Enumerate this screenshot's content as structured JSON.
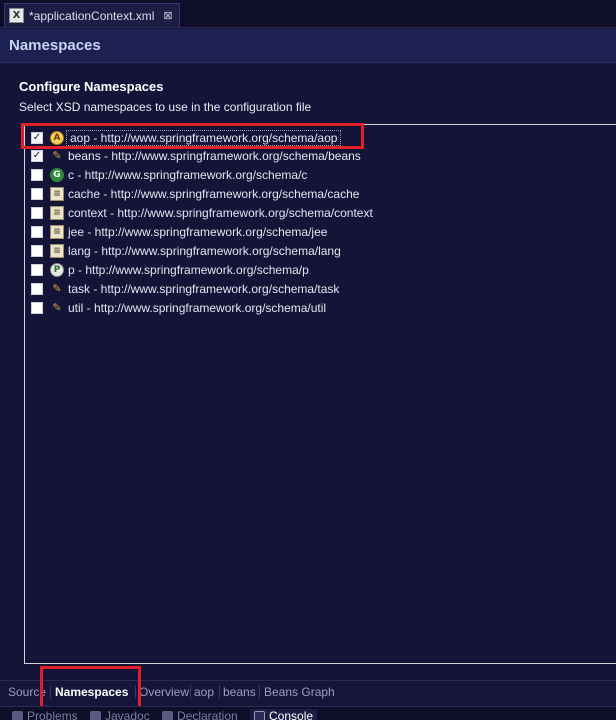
{
  "editor": {
    "tab_icon_glyph": "X",
    "tab_title": "*applicationContext.xml",
    "close_glyph": "⊠"
  },
  "page": {
    "title": "Namespaces"
  },
  "section": {
    "title": "Configure Namespaces",
    "description": "Select XSD namespaces to use in the configuration file"
  },
  "namespaces": [
    {
      "label": "aop - http://www.springframework.org/schema/aop",
      "checked": true,
      "icon": "aop-icon",
      "glyph": "A"
    },
    {
      "label": "beans - http://www.springframework.org/schema/beans",
      "checked": true,
      "icon": "bean-icon",
      "glyph": "✎"
    },
    {
      "label": "c - http://www.springframework.org/schema/c",
      "checked": false,
      "icon": "c-icon",
      "glyph": "G"
    },
    {
      "label": "cache - http://www.springframework.org/schema/cache",
      "checked": false,
      "icon": "cache-icon",
      "glyph": "≡"
    },
    {
      "label": "context - http://www.springframework.org/schema/context",
      "checked": false,
      "icon": "context-icon",
      "glyph": "≡"
    },
    {
      "label": "jee - http://www.springframework.org/schema/jee",
      "checked": false,
      "icon": "jee-icon",
      "glyph": "≡"
    },
    {
      "label": "lang - http://www.springframework.org/schema/lang",
      "checked": false,
      "icon": "lang-icon",
      "glyph": "≡"
    },
    {
      "label": "p - http://www.springframework.org/schema/p",
      "checked": false,
      "icon": "p-icon",
      "glyph": "P"
    },
    {
      "label": "task - http://www.springframework.org/schema/task",
      "checked": false,
      "icon": "task-icon",
      "glyph": "✎"
    },
    {
      "label": "util - http://www.springframework.org/schema/util",
      "checked": false,
      "icon": "util-icon",
      "glyph": "✎"
    }
  ],
  "check_glyph": "✓",
  "editor_tabs": [
    "Source",
    "Namespaces",
    "Overview",
    "aop",
    "beans",
    "Beans Graph"
  ],
  "active_editor_tab": "Namespaces",
  "view_tabs": [
    "Problems",
    "Javadoc",
    "Declaration",
    "Console"
  ],
  "active_view_tab": "Console",
  "colors": {
    "highlight": "#e01f2a",
    "background": "#141438",
    "header": "#1d2151"
  }
}
